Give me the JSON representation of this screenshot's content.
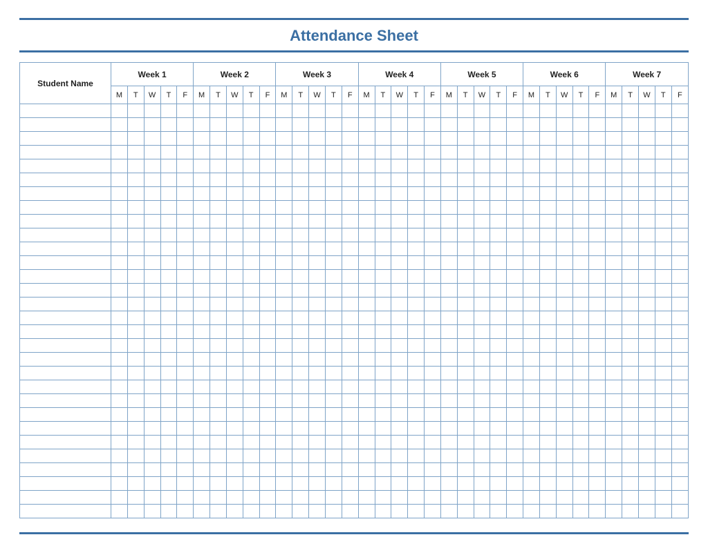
{
  "title": "Attendance Sheet",
  "columns": {
    "name_header": "Student Name",
    "weeks": [
      "Week 1",
      "Week 2",
      "Week 3",
      "Week 4",
      "Week 5",
      "Week 6",
      "Week 7"
    ],
    "days": [
      "M",
      "T",
      "W",
      "T",
      "F"
    ]
  },
  "rows": [
    {
      "name": "",
      "marks": []
    },
    {
      "name": "",
      "marks": []
    },
    {
      "name": "",
      "marks": []
    },
    {
      "name": "",
      "marks": []
    },
    {
      "name": "",
      "marks": []
    },
    {
      "name": "",
      "marks": []
    },
    {
      "name": "",
      "marks": []
    },
    {
      "name": "",
      "marks": []
    },
    {
      "name": "",
      "marks": []
    },
    {
      "name": "",
      "marks": []
    },
    {
      "name": "",
      "marks": []
    },
    {
      "name": "",
      "marks": []
    },
    {
      "name": "",
      "marks": []
    },
    {
      "name": "",
      "marks": []
    },
    {
      "name": "",
      "marks": []
    },
    {
      "name": "",
      "marks": []
    },
    {
      "name": "",
      "marks": []
    },
    {
      "name": "",
      "marks": []
    },
    {
      "name": "",
      "marks": []
    },
    {
      "name": "",
      "marks": []
    },
    {
      "name": "",
      "marks": []
    },
    {
      "name": "",
      "marks": []
    },
    {
      "name": "",
      "marks": []
    },
    {
      "name": "",
      "marks": []
    },
    {
      "name": "",
      "marks": []
    },
    {
      "name": "",
      "marks": []
    },
    {
      "name": "",
      "marks": []
    },
    {
      "name": "",
      "marks": []
    },
    {
      "name": "",
      "marks": []
    },
    {
      "name": "",
      "marks": []
    }
  ],
  "colors": {
    "accent": "#3b6fa3",
    "grid": "#7ea3c7"
  }
}
